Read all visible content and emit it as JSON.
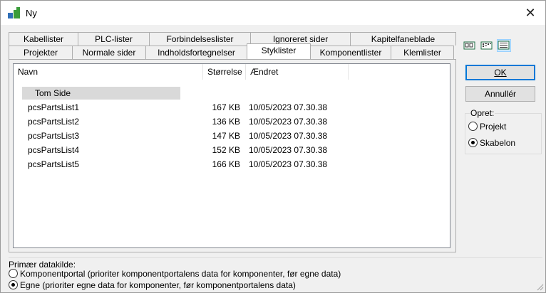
{
  "window": {
    "title": "Ny",
    "close_glyph": "✕"
  },
  "tabs_back": [
    "Kabellister",
    "PLC-lister",
    "Forbindelseslister",
    "Ignoreret sider",
    "Kapitelfaneblade"
  ],
  "tabs_front": [
    "Projekter",
    "Normale sider",
    "Indholdsfortegnelser",
    "Styklister",
    "Komponentlister",
    "Klemlister"
  ],
  "active_tab": "Styklister",
  "list": {
    "columns": [
      "Navn",
      "Størrelse",
      "Ændret"
    ],
    "rows": [
      {
        "name": "Tom Side",
        "size": "",
        "modified": ""
      },
      {
        "name": "pcsPartsList1",
        "size": "167 KB",
        "modified": "10/05/2023 07.30.38"
      },
      {
        "name": "pcsPartsList2",
        "size": "136 KB",
        "modified": "10/05/2023 07.30.38"
      },
      {
        "name": "pcsPartsList3",
        "size": "147 KB",
        "modified": "10/05/2023 07.30.38"
      },
      {
        "name": "pcsPartsList4",
        "size": "152 KB",
        "modified": "10/05/2023 07.30.38"
      },
      {
        "name": "pcsPartsList5",
        "size": "166 KB",
        "modified": "10/05/2023 07.30.38"
      }
    ]
  },
  "view_icons": [
    "large-icons-view-icon",
    "list-view-icon",
    "details-view-icon"
  ],
  "buttons": {
    "ok": "OK",
    "cancel": "Annullér"
  },
  "create_group": {
    "label": "Opret:",
    "options": [
      {
        "label": "Projekt",
        "checked": false
      },
      {
        "label": "Skabelon",
        "checked": true
      }
    ]
  },
  "datasource_group": {
    "label": "Primær datakilde:",
    "options": [
      {
        "label": "Komponentportal (prioriter komponentportalens data for komponenter, før egne data)",
        "checked": false
      },
      {
        "label": "Egne (prioriter egne data for komponenter, før komponentportalens data)",
        "checked": true
      }
    ]
  },
  "colors": {
    "accent": "#0078d7",
    "selection": "#d9d9d9",
    "view_active": "#cce8ff"
  }
}
